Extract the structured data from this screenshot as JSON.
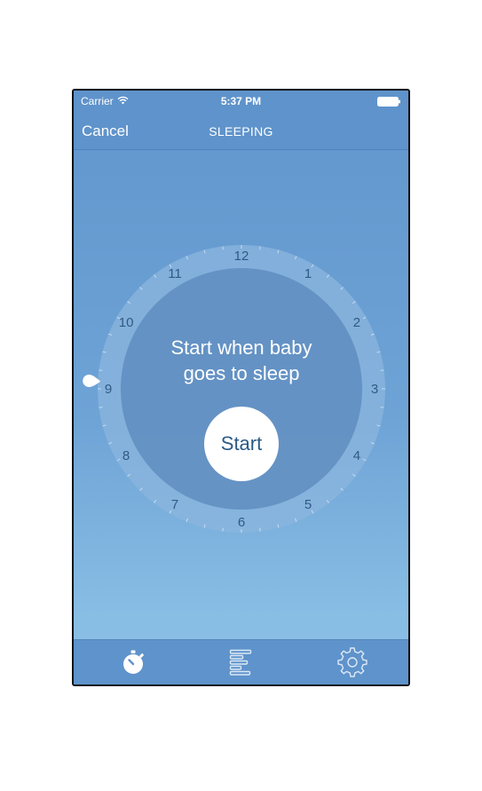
{
  "status_bar": {
    "carrier": "Carrier",
    "time": "5:37 PM",
    "wifi_icon": "wifi-icon",
    "battery_icon": "battery-icon"
  },
  "nav_bar": {
    "cancel_label": "Cancel",
    "title": "SLEEPING"
  },
  "dial": {
    "hours": [
      "12",
      "1",
      "2",
      "3",
      "4",
      "5",
      "6",
      "7",
      "8",
      "9",
      "10",
      "11"
    ],
    "prompt_line1": "Start when baby",
    "prompt_line2": "goes to sleep",
    "start_label": "Start",
    "marker_icon": "drop-marker-icon",
    "marker_hour": 9.1
  },
  "tab_bar": {
    "tabs": [
      {
        "icon": "stopwatch-icon",
        "selected": true
      },
      {
        "icon": "timeline-icon",
        "selected": false
      },
      {
        "icon": "gear-icon",
        "selected": false
      }
    ]
  },
  "colors": {
    "background_top": "#6196cd",
    "background_bottom": "#8cc0e6",
    "bars": "#5f93cb",
    "dial_ring": "#8bb6de",
    "dial_face": "#5f8dbf",
    "hour_labels": "#2f5a84",
    "start_button": "#ffffff",
    "start_text": "#2b5a86"
  }
}
